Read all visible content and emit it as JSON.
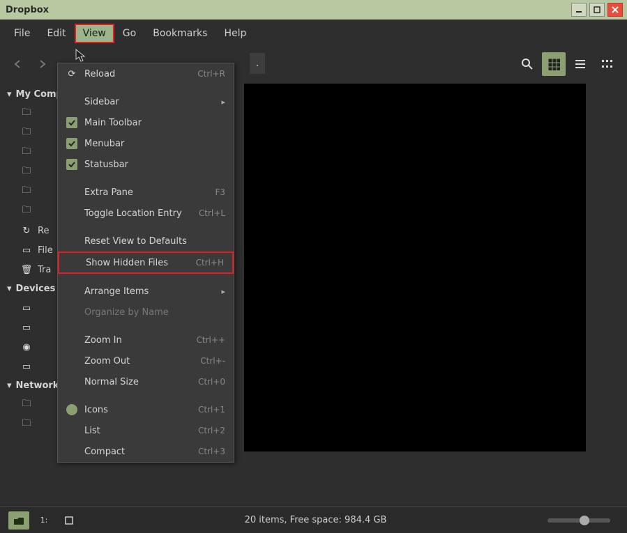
{
  "window": {
    "title": "Dropbox"
  },
  "menubar": {
    "items": [
      "File",
      "Edit",
      "View",
      "Go",
      "Bookmarks",
      "Help"
    ],
    "open_index": 2
  },
  "toolbar": {
    "breadcrumb_tail": "."
  },
  "view_menu": {
    "reload": {
      "label": "Reload",
      "accel": "Ctrl+R"
    },
    "sidebar": {
      "label": "Sidebar"
    },
    "main_toolbar": {
      "label": "Main Toolbar"
    },
    "menubar": {
      "label": "Menubar"
    },
    "statusbar": {
      "label": "Statusbar"
    },
    "extra_pane": {
      "label": "Extra Pane",
      "accel": "F3"
    },
    "toggle_loc": {
      "label": "Toggle Location Entry",
      "accel": "Ctrl+L"
    },
    "reset_view": {
      "label": "Reset View to Defaults"
    },
    "show_hidden": {
      "label": "Show Hidden Files",
      "accel": "Ctrl+H"
    },
    "arrange": {
      "label": "Arrange Items"
    },
    "organize": {
      "label": "Organize by Name"
    },
    "zoom_in": {
      "label": "Zoom In",
      "accel": "Ctrl++"
    },
    "zoom_out": {
      "label": "Zoom Out",
      "accel": "Ctrl+-"
    },
    "normal_size": {
      "label": "Normal Size",
      "accel": "Ctrl+0"
    },
    "icons": {
      "label": "Icons",
      "accel": "Ctrl+1"
    },
    "list": {
      "label": "List",
      "accel": "Ctrl+2"
    },
    "compact": {
      "label": "Compact",
      "accel": "Ctrl+3"
    }
  },
  "sidebar": {
    "sections": {
      "computer": {
        "label": "My Computer",
        "items": [
          "",
          "",
          "",
          "",
          "",
          "",
          "Re",
          "File",
          "Tra"
        ]
      },
      "devices": {
        "label": "Devices",
        "items": [
          "",
          "",
          "",
          ""
        ]
      },
      "network": {
        "label": "Network",
        "items": [
          "",
          ""
        ]
      }
    }
  },
  "statusbar": {
    "text": "20 items, Free space: 984.4 GB",
    "path_mode": "1:"
  }
}
